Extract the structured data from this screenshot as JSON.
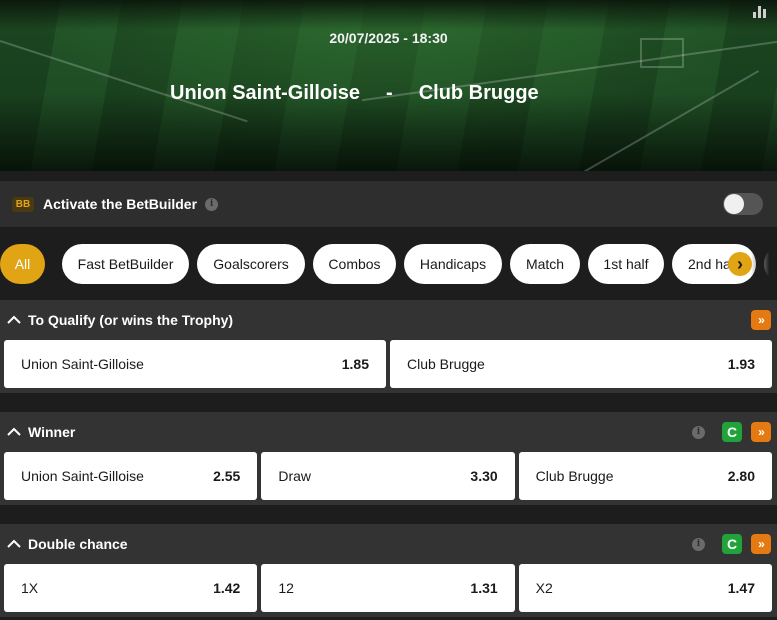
{
  "match": {
    "datetime": "20/07/2025 - 18:30",
    "home": "Union Saint-Gilloise",
    "separator": "-",
    "away": "Club Brugge"
  },
  "betbuilder": {
    "badge": "BB",
    "label": "Activate the BetBuilder",
    "info_icon": "i",
    "toggle_on": false
  },
  "filters": {
    "items": [
      "All",
      "Fast BetBuilder",
      "Goalscorers",
      "Combos",
      "Handicaps",
      "Match",
      "1st half",
      "2nd half"
    ],
    "active": "All",
    "next_icon": "›"
  },
  "markets": [
    {
      "title": "To Qualify (or wins the Trophy)",
      "selections": [
        {
          "label": "Union Saint-Gilloise",
          "price": "1.85"
        },
        {
          "label": "Club Brugge",
          "price": "1.93"
        }
      ]
    },
    {
      "title": "Winner",
      "selections": [
        {
          "label": "Union Saint-Gilloise",
          "price": "2.55"
        },
        {
          "label": "Draw",
          "price": "3.30"
        },
        {
          "label": "Club Brugge",
          "price": "2.80"
        }
      ]
    },
    {
      "title": "Double chance",
      "selections": [
        {
          "label": "1X",
          "price": "1.42"
        },
        {
          "label": "12",
          "price": "1.31"
        },
        {
          "label": "X2",
          "price": "1.47"
        }
      ]
    }
  ],
  "icons": {
    "collapse": "chevron-up-icon",
    "info": "i",
    "cashout": "C",
    "expand": "»"
  },
  "colors": {
    "accent": "#e0a414",
    "cashout_green": "#1fa33a",
    "expand_orange": "#e37a12"
  }
}
